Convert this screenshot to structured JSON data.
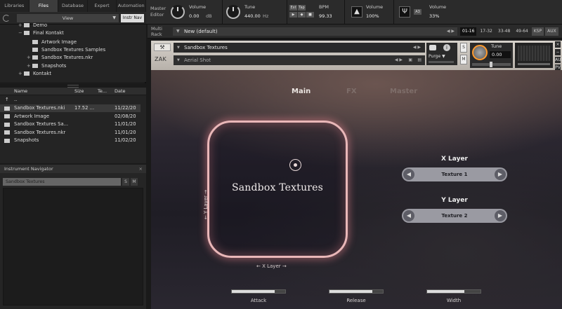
{
  "browser": {
    "tabs": [
      "Libraries",
      "Files",
      "Database",
      "Expert",
      "Automation"
    ],
    "active_tab": "Files",
    "view_label": "View",
    "instr_nav_label": "Instr Nav"
  },
  "tree": [
    {
      "label": "Demo",
      "depth": 1,
      "toggle": "+"
    },
    {
      "label": "Final Kontakt",
      "depth": 1,
      "toggle": "−"
    },
    {
      "label": "Artwork Image",
      "depth": 2,
      "toggle": ""
    },
    {
      "label": "Sandbox Textures Samples",
      "depth": 2,
      "toggle": ""
    },
    {
      "label": "Sandbox Textures.nkr",
      "depth": 2,
      "toggle": "+"
    },
    {
      "label": "Snapshots",
      "depth": 2,
      "toggle": "+"
    },
    {
      "label": "Kontakt",
      "depth": 1,
      "toggle": "+"
    }
  ],
  "files": {
    "headers": {
      "name": "Name",
      "size": "Size",
      "type": "Te...",
      "date": "Date"
    },
    "up": "..",
    "rows": [
      {
        "name": "Sandbox Textures.nki",
        "size": "17.52 ...",
        "date": "11/22/20",
        "selected": true
      },
      {
        "name": "Artwork Image",
        "size": "",
        "date": "02/08/20",
        "selected": false
      },
      {
        "name": "Sandbox Textures Sa...",
        "size": "",
        "date": "11/01/20",
        "selected": false
      },
      {
        "name": "Sandbox Textures.nkr",
        "size": "",
        "date": "11/01/20",
        "selected": false
      },
      {
        "name": "Snapshots",
        "size": "",
        "date": "11/02/20",
        "selected": false
      }
    ]
  },
  "navigator": {
    "title": "Instrument Navigator",
    "close": "×",
    "instrument": "Sandbox Textures",
    "s_label": "S",
    "m_label": "M"
  },
  "master": {
    "editor_label_1": "Master",
    "editor_label_2": "Editor",
    "volume_label": "Volume",
    "volume_value": "0.00",
    "volume_unit": "dB",
    "tune_label": "Tune",
    "tune_value": "440.00",
    "tune_unit": "Hz",
    "ext_label": "Ext",
    "tap_label": "Tap",
    "bpm_label": "BPM",
    "bpm_value": "99.33",
    "vol2_label": "Volume",
    "vol2_value": "100%",
    "vol3_label": "Volume",
    "vol3_value": "33%"
  },
  "rack": {
    "multi_label_1": "Multi",
    "multi_label_2": "Rack",
    "preset_name": "New (default)",
    "pages": [
      "01-16",
      "17-32",
      "33-48",
      "49-64",
      "KSP",
      "AUX"
    ],
    "active_page": "01-16"
  },
  "instrument": {
    "logo_text": "ZAK",
    "name": "Sandbox Textures",
    "snapshot": "Aerial Shot",
    "purge_label": "Purge",
    "info_label": "i",
    "s_label": "S",
    "m_label": "M",
    "tune_label": "Tune",
    "tune_value": "0.00",
    "side_labels": [
      "×",
      "−",
      "AUX",
      "PV"
    ]
  },
  "panel": {
    "tabs": [
      "Main",
      "FX",
      "Master"
    ],
    "active_tab": "Main",
    "pad_title": "Sandbox Textures",
    "y_axis_label": "← Y Layer →",
    "x_axis_label": "← X Layer →",
    "x_layer": {
      "title": "X Layer",
      "value": "Texture 1"
    },
    "y_layer": {
      "title": "Y Layer",
      "value": "Texture 2"
    },
    "controls": [
      {
        "label": "Attack",
        "value": 0.8
      },
      {
        "label": "Release",
        "value": 0.8
      },
      {
        "label": "Width",
        "value": 0.7
      }
    ],
    "colors": {
      "pad_border": "#e9b7b8",
      "pad_glow": "#e6828c",
      "tune_knob_ring": "#ff9a2e"
    }
  }
}
